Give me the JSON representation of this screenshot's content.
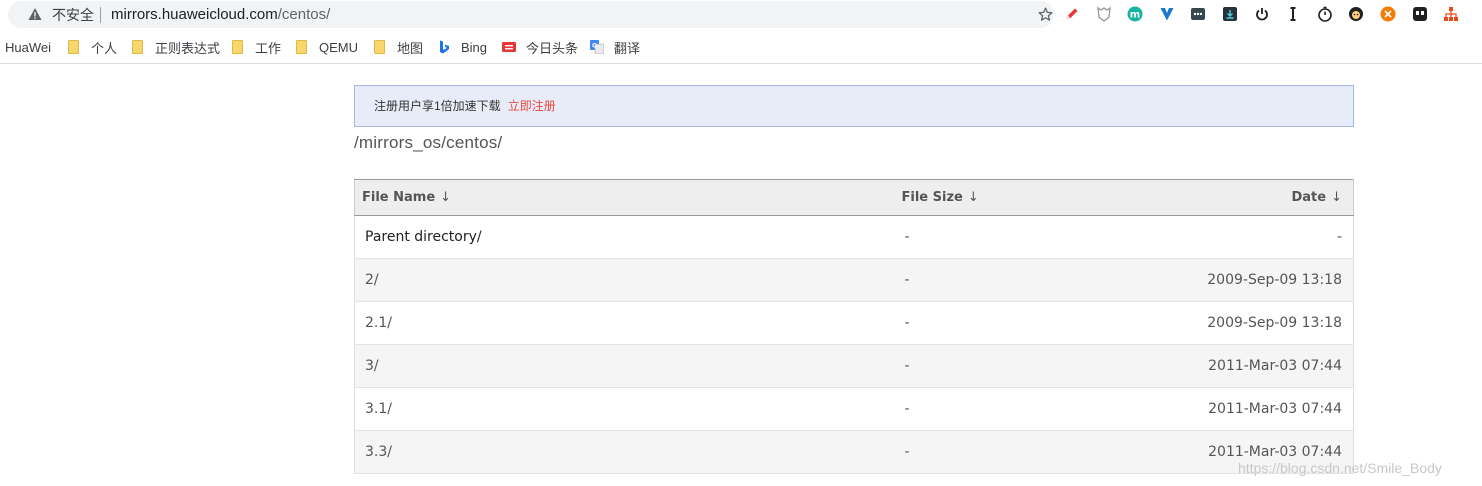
{
  "browser": {
    "insecure_label": "不安全",
    "url_host": "mirrors.huaweicloud.com",
    "url_path": "/centos/",
    "extensions": [
      "pen-extension-icon",
      "mask-extension-icon",
      "m-extension-icon",
      "v-extension-icon",
      "dots-extension-icon",
      "download-extension-icon",
      "power-extension-icon",
      "text-cursor-extension-icon",
      "timer-extension-icon",
      "avatar-extension-icon",
      "orange-extension-icon",
      "game-extension-icon",
      "sitemap-extension-icon"
    ]
  },
  "bookmarks": [
    {
      "label": "HuaWei",
      "icon": "none"
    },
    {
      "label": "个人",
      "icon": "folder"
    },
    {
      "label": "正则表达式",
      "icon": "folder"
    },
    {
      "label": "工作",
      "icon": "folder"
    },
    {
      "label": "QEMU",
      "icon": "folder"
    },
    {
      "label": "地图",
      "icon": "folder"
    },
    {
      "label": "Bing",
      "icon": "bing"
    },
    {
      "label": "今日头条",
      "icon": "toutiao"
    },
    {
      "label": "翻译",
      "icon": "translate"
    }
  ],
  "banner": {
    "text": "注册用户享1倍加速下载",
    "register_link": "立即注册"
  },
  "breadcrumb": "/mirrors_os/centos/",
  "table": {
    "columns": [
      "File Name",
      "File Size",
      "Date"
    ],
    "sort_arrow": "↓",
    "rows": [
      {
        "name": "Parent directory/",
        "size": "-",
        "date": "-"
      },
      {
        "name": "2/",
        "size": "-",
        "date": "2009-Sep-09 13:18"
      },
      {
        "name": "2.1/",
        "size": "-",
        "date": "2009-Sep-09 13:18"
      },
      {
        "name": "3/",
        "size": "-",
        "date": "2011-Mar-03 07:44"
      },
      {
        "name": "3.1/",
        "size": "-",
        "date": "2011-Mar-03 07:44"
      },
      {
        "name": "3.3/",
        "size": "-",
        "date": "2011-Mar-03 07:44"
      }
    ]
  },
  "watermark": "https://blog.csdn.net/Smile_Body",
  "colors": {
    "banner_bg": "#e8ecf9",
    "banner_border": "#a5b5e6",
    "register_link": "#e84a3c",
    "folder": "#f7d76c"
  }
}
